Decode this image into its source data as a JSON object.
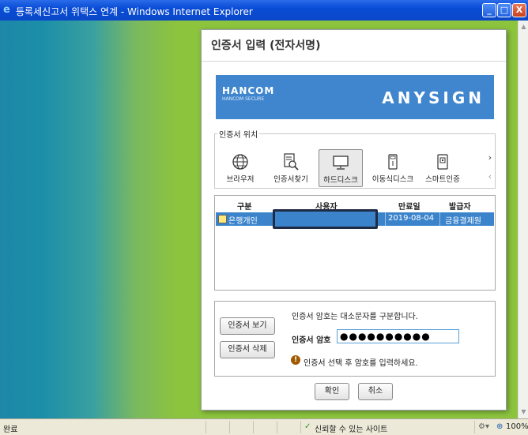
{
  "window": {
    "title": "등록세신고서 위택스 연계 - Windows Internet Explorer",
    "min_glyph": "_",
    "max_glyph": "□",
    "close_glyph": "X"
  },
  "dialog": {
    "title": "인증서 입력 (전자서명)",
    "banner": {
      "brand": "HANCOM",
      "brand_sub": "HANCOM SECURE",
      "product": "ANYSIGN",
      "color": "#3f86cf"
    },
    "location": {
      "legend": "인증서 위치",
      "items": [
        {
          "label": "브라우저",
          "icon": "globe-icon",
          "active": false
        },
        {
          "label": "인증서찾기",
          "icon": "find-cert-icon",
          "active": false
        },
        {
          "label": "하드디스크",
          "icon": "monitor-icon",
          "active": true
        },
        {
          "label": "이동식디스크",
          "icon": "usb-icon",
          "active": false
        },
        {
          "label": "스마트인증",
          "icon": "smart-card-icon",
          "active": false
        }
      ],
      "next_arrow": "›",
      "prev_arrow": "‹"
    },
    "table": {
      "columns": [
        "구분",
        "사용자",
        "만료일",
        "발급자"
      ],
      "rows": [
        {
          "type": "은행개인",
          "user": "",
          "expiry": "2019-08-04",
          "issuer": "금융결제원",
          "selected": true
        }
      ]
    },
    "password": {
      "notice": "인증서 암호는 대소문자를 구분합니다.",
      "label": "인증서 암호",
      "value": "●●●●●●●●●●",
      "warning": "인증서 선택 후 암호를 입력하세요."
    },
    "buttons": {
      "view_cert": "인증서 보기",
      "delete_cert": "인증서 삭제",
      "ok": "확인",
      "cancel": "취소"
    }
  },
  "statusbar": {
    "status": "완료",
    "zone": "신뢰할 수 있는 사이트",
    "zoom": "100%"
  },
  "colors": {
    "accent": "#3b84cc",
    "title_bar": "#0a4cd6",
    "bg_green": "#8cc43e",
    "bg_teal": "#1d87a8"
  }
}
